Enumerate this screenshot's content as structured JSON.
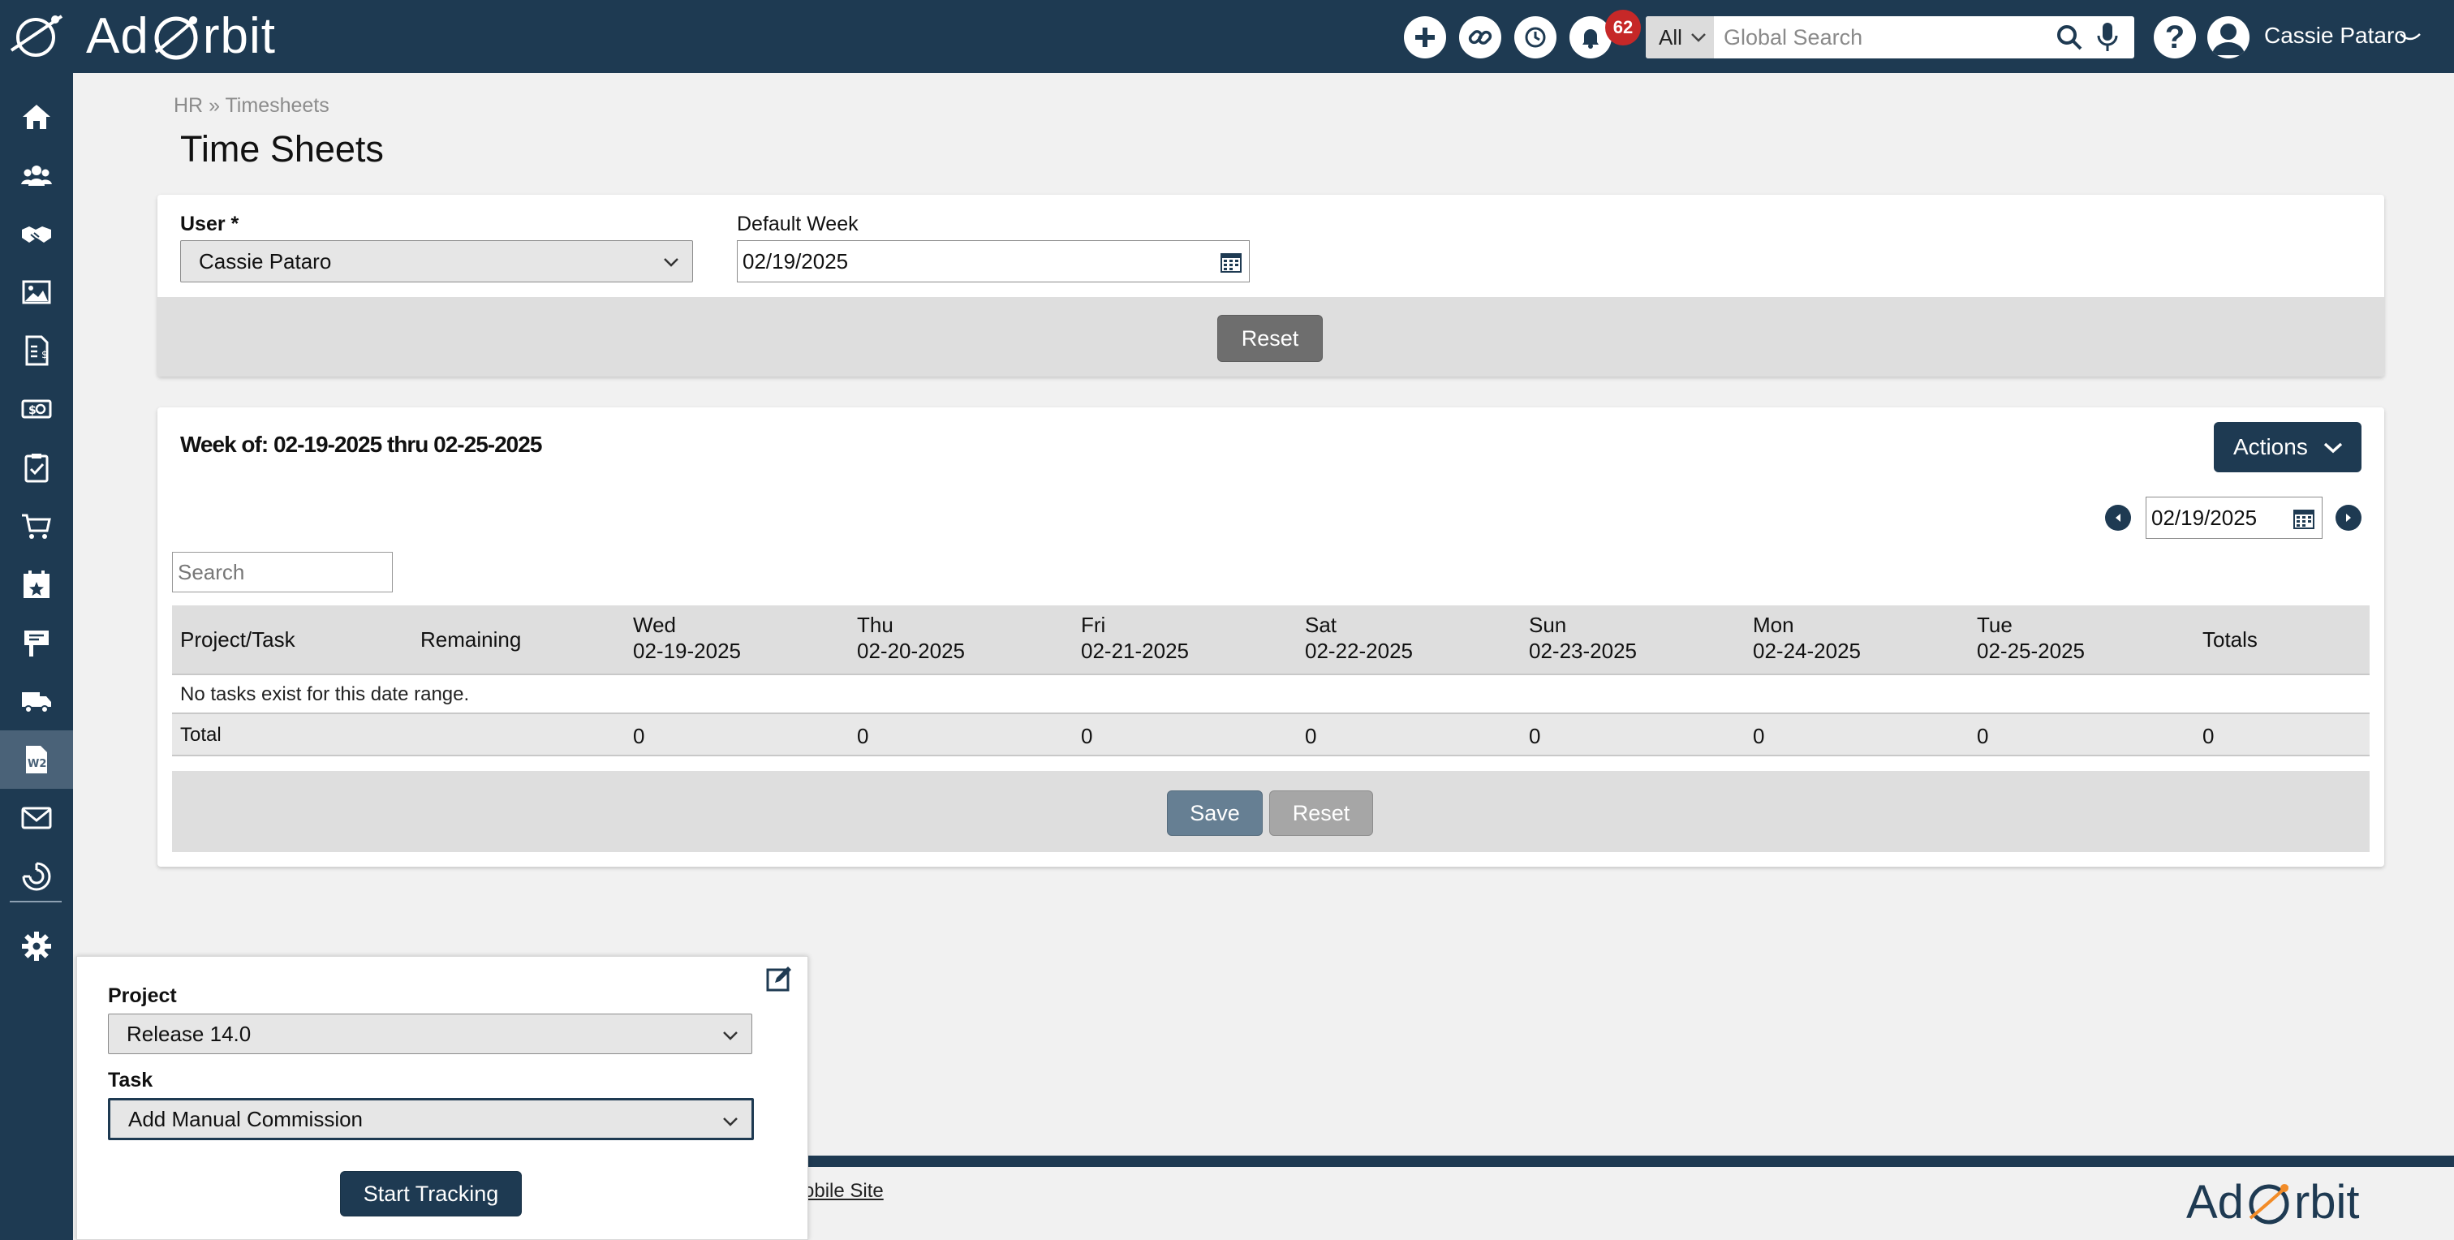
{
  "app": {
    "brand_prefix": "Ad",
    "brand_suffix": "rbit",
    "brand_color": "#1e3a52"
  },
  "header": {
    "notifications_count": "62",
    "search_scope": "All",
    "search_placeholder": "Global Search",
    "user_name": "Cassie Pataro",
    "help_label": "?"
  },
  "sidebar": {
    "items": [
      {
        "icon": "home-icon"
      },
      {
        "icon": "contacts-icon"
      },
      {
        "icon": "handshake-icon"
      },
      {
        "icon": "image-icon"
      },
      {
        "icon": "invoice-icon"
      },
      {
        "icon": "money-icon"
      },
      {
        "icon": "clipboard-check-icon"
      },
      {
        "icon": "cart-icon"
      },
      {
        "icon": "calendar-star-icon"
      },
      {
        "icon": "sign-icon"
      },
      {
        "icon": "truck-icon"
      },
      {
        "icon": "w2-icon",
        "active": true
      },
      {
        "icon": "mail-icon"
      },
      {
        "icon": "chart-icon"
      },
      {
        "icon": "gear-icon"
      }
    ]
  },
  "breadcrumb": {
    "parent": "HR",
    "separator": "»",
    "current": "Timesheets"
  },
  "page_title": "Time Sheets",
  "filters": {
    "user_label": "User *",
    "user_value": "Cassie Pataro",
    "default_week_label": "Default Week",
    "default_week_value": "02/19/2025",
    "reset_label": "Reset"
  },
  "timesheet": {
    "week_title": "Week of: 02-19-2025 thru 02-25-2025",
    "actions_label": "Actions",
    "nav_date": "02/19/2025",
    "search_placeholder": "Search",
    "columns": [
      {
        "title": "Project/Task",
        "date": ""
      },
      {
        "title": "Remaining",
        "date": ""
      },
      {
        "title": "Wed",
        "date": "02-19-2025"
      },
      {
        "title": "Thu",
        "date": "02-20-2025"
      },
      {
        "title": "Fri",
        "date": "02-21-2025"
      },
      {
        "title": "Sat",
        "date": "02-22-2025"
      },
      {
        "title": "Sun",
        "date": "02-23-2025"
      },
      {
        "title": "Mon",
        "date": "02-24-2025"
      },
      {
        "title": "Tue",
        "date": "02-25-2025"
      },
      {
        "title": "Totals",
        "date": ""
      }
    ],
    "empty_message": "No tasks exist for this date range.",
    "total_label": "Total",
    "totals": [
      "0",
      "0",
      "0",
      "0",
      "0",
      "0",
      "0",
      "0"
    ],
    "save_label": "Save",
    "reset_label": "Reset"
  },
  "tracker": {
    "project_label": "Project",
    "project_value": "Release 14.0",
    "task_label": "Task",
    "task_value": "Add Manual Commission",
    "start_label": "Start Tracking"
  },
  "footer": {
    "link_label": "obile Site",
    "logo_prefix": "Ad",
    "logo_suffix": "rbit"
  }
}
